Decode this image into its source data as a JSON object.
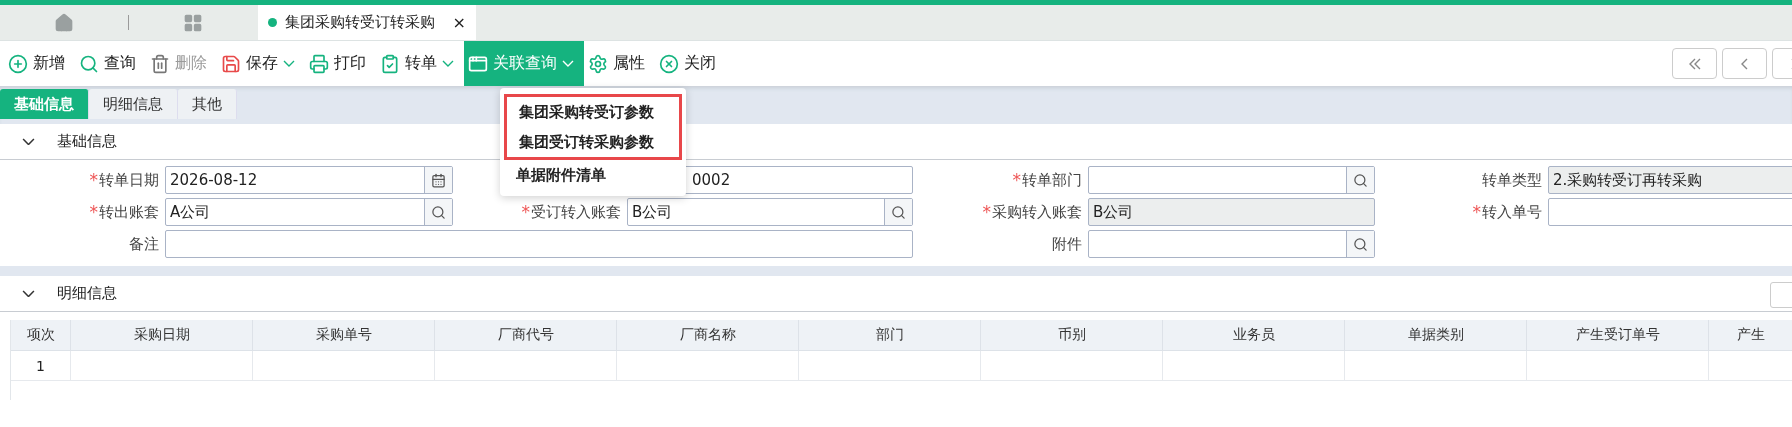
{
  "tabs": {
    "active": {
      "title": "集团采购转受订转采购",
      "close": "×",
      "selected": true
    }
  },
  "toolbar": [
    {
      "label": "新增",
      "kind": "button",
      "disabled": false,
      "selected": false
    },
    {
      "label": "查询",
      "kind": "button",
      "disabled": false,
      "selected": false
    },
    {
      "label": "删除",
      "kind": "button",
      "disabled": true,
      "selected": false
    },
    {
      "label": "保存",
      "kind": "dropdown",
      "disabled": false,
      "selected": false
    },
    {
      "label": "打印",
      "kind": "button",
      "disabled": false,
      "selected": false
    },
    {
      "label": "转单",
      "kind": "dropdown",
      "disabled": false,
      "selected": false
    },
    {
      "label": "关联查询",
      "kind": "dropdown",
      "disabled": false,
      "selected": true
    },
    {
      "label": "属性",
      "kind": "button",
      "disabled": false,
      "selected": false
    },
    {
      "label": "关闭",
      "kind": "button",
      "disabled": false,
      "selected": false
    }
  ],
  "menu": {
    "items": [
      {
        "label": "集团采购转受订参数",
        "highlighted": true
      },
      {
        "label": "集团受订转采购参数",
        "highlighted": true
      },
      {
        "label": "单据附件清单",
        "highlighted": false
      }
    ]
  },
  "subtabs": [
    {
      "label": "基础信息",
      "selected": true
    },
    {
      "label": "明细信息",
      "selected": false
    },
    {
      "label": "其他",
      "selected": false
    }
  ],
  "basic_section": {
    "title": "基础信息",
    "expanded": true,
    "rows": [
      [
        {
          "mark": "*",
          "label": "转单日期",
          "value": "2026-08-12",
          "kind": "date"
        },
        {
          "value": "0002",
          "kind": "covered"
        },
        {
          "mark": "*",
          "label": "转单部门",
          "kind": "lookup"
        },
        {
          "label": "转单类型",
          "value": "2.采购转受订再转采购",
          "kind": "readonly"
        }
      ],
      [
        {
          "mark": "*",
          "label": "转出账套",
          "value": "A公司",
          "kind": "lookup"
        },
        {
          "mark": "*",
          "label": "受订转入账套",
          "value": "B公司",
          "kind": "lookup"
        },
        {
          "mark": "*",
          "label": "采购转入账套",
          "value": "B公司",
          "kind": "readonly"
        },
        {
          "mark": "*",
          "label": "转入单号",
          "kind": "text"
        }
      ],
      [
        {
          "label": "备注",
          "kind": "wide"
        },
        "",
        {
          "label": "附件",
          "kind": "lookup"
        }
      ]
    ]
  },
  "detail_section": {
    "title": "明细信息",
    "expanded": true,
    "table": {
      "columns": [
        "项次",
        "采购日期",
        "采购单号",
        "厂商代号",
        "厂商名称",
        "部门",
        "币别",
        "业务员",
        "单据类别",
        "产生受订单号",
        "产生"
      ],
      "rows": [
        [
          "1",
          "",
          "",
          "",
          "",
          "",
          "",
          "",
          "",
          "",
          ""
        ]
      ]
    }
  }
}
